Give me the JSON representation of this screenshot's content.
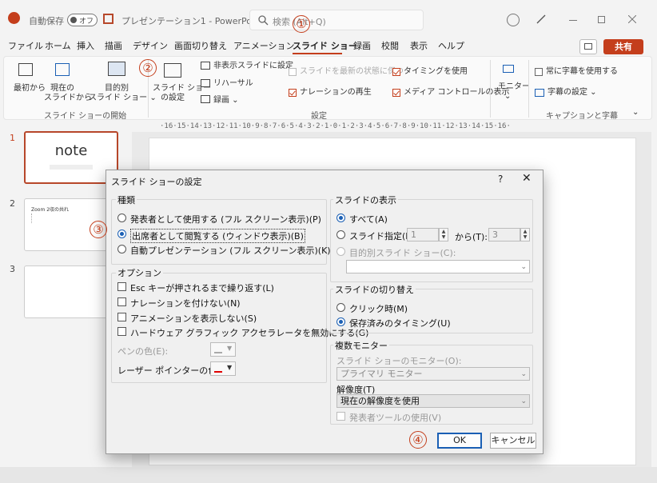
{
  "titlebar": {
    "autosave_label": "自動保存",
    "autosave_state": "オフ",
    "doc_title": "プレゼンテーション1 - PowerPoint",
    "search_placeholder": "検索 (Alt+Q)"
  },
  "menu": {
    "items": [
      "ファイル",
      "ホーム",
      "挿入",
      "描画",
      "デザイン",
      "画面切り替え",
      "アニメーション",
      "スライド ショー",
      "録画",
      "校閲",
      "表示",
      "ヘルプ"
    ],
    "active": "スライド ショー",
    "share_label": "共有"
  },
  "ribbon": {
    "from_start": "最初から",
    "from_current_1": "現在の",
    "from_current_2": "スライドから",
    "custom_1": "目的別",
    "custom_2": "スライド ショー ⌄",
    "setup_1": "スライド ショー",
    "setup_2": "の設定",
    "hide_slide": "非表示スライドに設定",
    "rehearse": "リハーサル",
    "record": "録画 ⌄",
    "keep_updated": "スライドを最新の状態に保つ",
    "use_timings": "タイミングを使用",
    "play_narration": "ナレーションの再生",
    "show_media": "メディア コントロールの表示",
    "monitor": "モニター",
    "always_subtitles": "常に字幕を使用する",
    "subtitle_settings": "字幕の設定 ⌄",
    "group_start": "スライド ショーの開始",
    "group_setup": "設定",
    "group_captions": "キャプションと字幕"
  },
  "slides": {
    "numbers": [
      "1",
      "2",
      "3"
    ],
    "slide1_title": "note",
    "slide2_title": "Zoom 2収の共れ"
  },
  "ruler_text": "·16·15·14·13·12·11·10·9·8·7·6·5·4·3·2·1·0·1·2·3·4·5·6·7·8·9·10·11·12·13·14·15·16·",
  "dialog": {
    "title": "スライド ショーの設定",
    "help": "?",
    "close": "✕",
    "type_legend": "種類",
    "type_options": [
      "発表者として使用する (フル スクリーン表示)(P)",
      "出席者として閲覧する (ウィンドウ表示)(B)",
      "自動プレゼンテーション (フル スクリーン表示)(K)"
    ],
    "options_legend": "オプション",
    "option_items": [
      "Esc キーが押されるまで繰り返す(L)",
      "ナレーションを付けない(N)",
      "アニメーションを表示しない(S)",
      "ハードウェア グラフィック アクセラレータを無効にする(G)"
    ],
    "pen_color": "ペンの色(E):",
    "laser_color": "レーザー ポインターの色(R):",
    "show_legend": "スライドの表示",
    "show_all": "すべて(A)",
    "show_range": "スライド指定(F):",
    "range_from": "1",
    "range_to_label": "から(T):",
    "range_to": "3",
    "show_custom": "目的別スライド ショー(C):",
    "advance_legend": "スライドの切り替え",
    "advance_manual": "クリック時(M)",
    "advance_timings": "保存済みのタイミング(U)",
    "monitor_legend": "複数モニター",
    "monitor_label": "スライド ショーのモニター(O):",
    "monitor_value": "プライマリ モニター",
    "resolution_label": "解像度(T)",
    "resolution_value": "現在の解像度を使用",
    "presenter_view": "発表者ツールの使用(V)",
    "ok": "OK",
    "cancel": "キャンセル"
  },
  "annotations": [
    "①",
    "②",
    "③",
    "④"
  ],
  "colors": {
    "accent": "#c43e1c",
    "radio": "#1a5fb4",
    "laser": "#e00000",
    "pen": "#aaaaaa"
  }
}
